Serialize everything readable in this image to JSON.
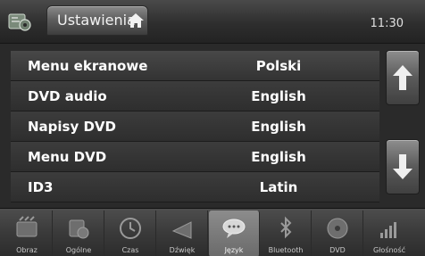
{
  "header": {
    "title": "Ustawienia",
    "time": "11:30"
  },
  "menu": {
    "items": [
      {
        "label": "Menu ekranowe",
        "value": "Polski"
      },
      {
        "label": "DVD audio",
        "value": "English"
      },
      {
        "label": "Napisy DVD",
        "value": "English"
      },
      {
        "label": "Menu DVD",
        "value": "English"
      },
      {
        "label": "ID3",
        "value": "Latin"
      }
    ]
  },
  "scroll": {
    "up_icon": "arrow-up-icon",
    "down_icon": "arrow-down-icon"
  },
  "bottom_tabs": [
    {
      "label": "Obraz",
      "icon": "picture-icon"
    },
    {
      "label": "Ogólne",
      "icon": "general-icon"
    },
    {
      "label": "Czas",
      "icon": "clock-icon"
    },
    {
      "label": "Dźwięk",
      "icon": "sound-icon"
    },
    {
      "label": "Język",
      "icon": "language-icon",
      "active": true
    },
    {
      "label": "Bluetooth",
      "icon": "bluetooth-icon"
    },
    {
      "label": "DVD",
      "icon": "dvd-icon"
    },
    {
      "label": "Głośność",
      "icon": "volume-icon"
    }
  ],
  "colors": {
    "background": "#2a2a2a",
    "row": "#353535",
    "text": "#ffffff",
    "active_tab": "#7a7a7a"
  }
}
